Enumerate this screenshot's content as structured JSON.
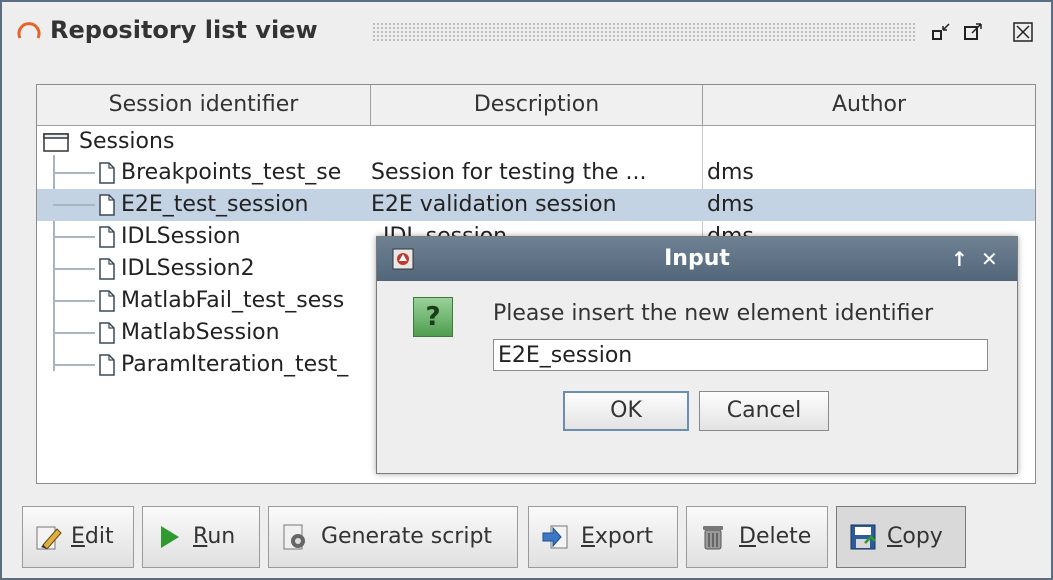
{
  "window": {
    "title": "Repository list view"
  },
  "table": {
    "columns": [
      "Session identifier",
      "Description",
      "Author"
    ],
    "root": {
      "label": "Sessions"
    },
    "rows": [
      {
        "id": "Breakpoints_test_se",
        "description": "Session for testing the ...",
        "author": "dms"
      },
      {
        "id": "E2E_test_session",
        "description": "E2E validation session",
        "author": "dms"
      },
      {
        "id": "IDLSession",
        "description": "IDL session",
        "author": "dms"
      },
      {
        "id": "IDLSession2",
        "description": "",
        "author": ""
      },
      {
        "id": "MatlabFail_test_sess",
        "description": "",
        "author": ""
      },
      {
        "id": "MatlabSession",
        "description": "",
        "author": ""
      },
      {
        "id": "ParamIteration_test_",
        "description": "",
        "author": ""
      }
    ],
    "selected_row": "E2E_test_session"
  },
  "dialog": {
    "title": "Input",
    "message": "Please insert the new element identifier",
    "input_value": "E2E_session",
    "ok_label": "OK",
    "cancel_label": "Cancel",
    "question_glyph": "?"
  },
  "toolbar": {
    "edit": {
      "mnemonic": "E",
      "rest": "dit"
    },
    "run": {
      "mnemonic": "R",
      "rest": "un"
    },
    "generate_script": "Generate script",
    "export": {
      "mnemonic": "E",
      "rest": "xport"
    },
    "delete": {
      "mnemonic": "D",
      "rest": "elete"
    },
    "copy": {
      "mnemonic": "C",
      "rest": "opy"
    }
  },
  "colors": {
    "selection": "#c3d3e3",
    "dialog_title": "#5d7186",
    "question_icon": "#6ab86a"
  }
}
